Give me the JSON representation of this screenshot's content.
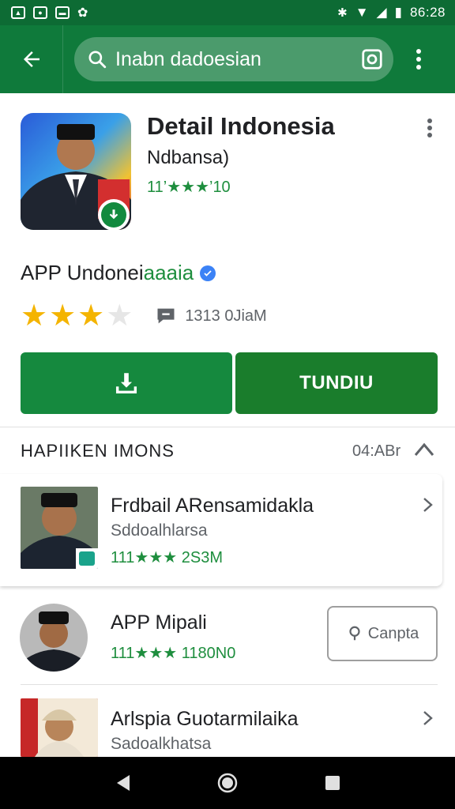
{
  "status_bar": {
    "time": "86:28"
  },
  "toolbar": {
    "search_text": "Inabn dadoesian"
  },
  "app": {
    "title": "Detail Indonesia",
    "developer": "Ndbansa)",
    "rating_line": "11’★★★’10",
    "subtitle_prefix": "APP Undonei",
    "subtitle_accent": "aaaia",
    "stars": 3.5,
    "review_count": "1313 0JiaM",
    "open_label": "TUNDIU"
  },
  "section": {
    "title": "HAPIIKEN IMONS",
    "meta": "04:ABr"
  },
  "items": [
    {
      "title": "Frdbail ARensamidakla",
      "subtitle": "Sddoalhlarsa",
      "rating": "111★★★ 2S3M"
    },
    {
      "title": "APP Mipali",
      "subtitle": "",
      "rating": "111★★★ 1180N0",
      "action_label": "Canpta"
    },
    {
      "title": "Arlspia Guotarmilaika",
      "subtitle": "Sadoalkhatsa",
      "rating": ""
    }
  ],
  "colors": {
    "primary": "#0f7a3b",
    "status": "#0d6b34",
    "accent": "#1e8e3e",
    "star": "#f4b400"
  },
  "icons": [
    "back-arrow-icon",
    "search-icon",
    "camera-icon",
    "overflow-menu-icon",
    "download-icon",
    "review-icon",
    "chevron-right-icon",
    "chevron-up-icon",
    "location-pin-icon",
    "verified-icon"
  ]
}
